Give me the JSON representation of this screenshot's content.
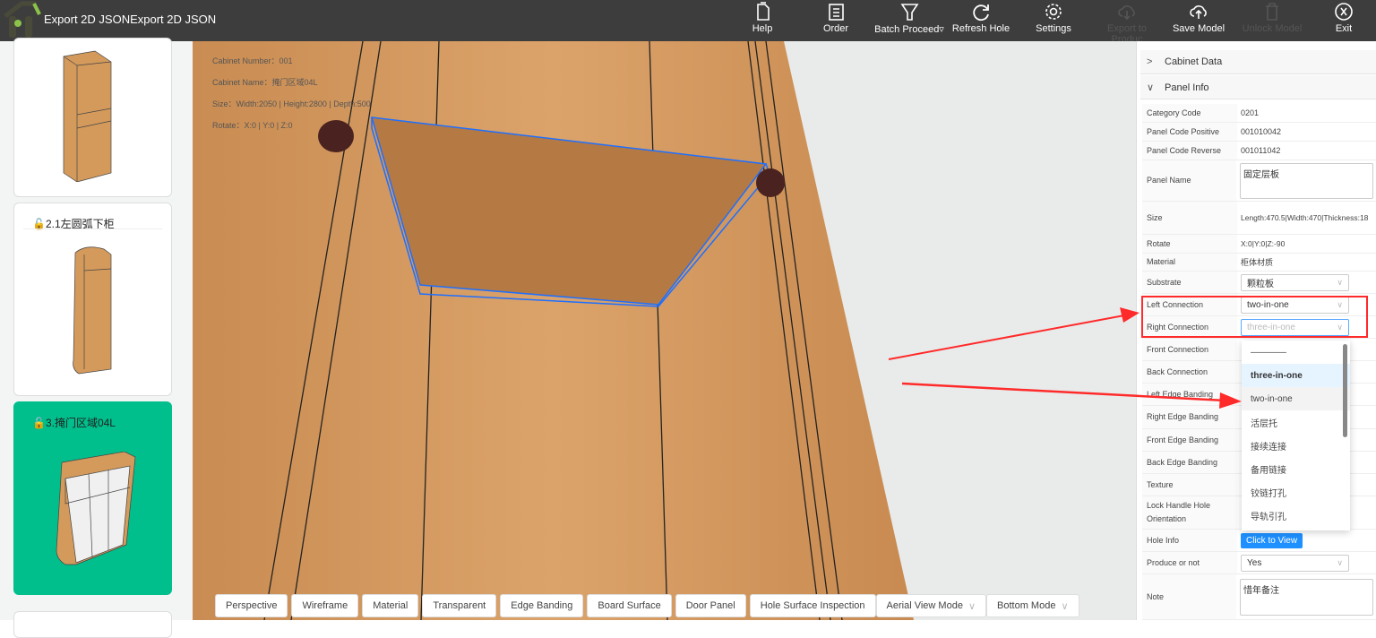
{
  "app": {
    "title": "Export 2D JSONExport 2D JSON"
  },
  "toolbar": [
    {
      "label": "Help",
      "icon": "help-doc-icon",
      "enabled": true
    },
    {
      "label": "Order",
      "icon": "order-list-icon",
      "enabled": true
    },
    {
      "label": "Batch Proceed▿",
      "icon": "funnel-icon",
      "enabled": true
    },
    {
      "label": "Refresh Hole",
      "icon": "refresh-icon",
      "enabled": true
    },
    {
      "label": "Settings",
      "icon": "gear-icon",
      "enabled": true
    },
    {
      "label": "Export to Produc",
      "icon": "cloud-download-icon",
      "enabled": false
    },
    {
      "label": "Save Model",
      "icon": "cloud-upload-icon",
      "enabled": true
    },
    {
      "label": "Unlock Model",
      "icon": "trash-icon",
      "enabled": false
    },
    {
      "label": "Exit",
      "icon": "close-circle-icon",
      "enabled": true
    }
  ],
  "sidebar": {
    "cards": [
      {
        "title": ""
      },
      {
        "title": "2.1左圆弧下柜"
      },
      {
        "title": "3.掩门区域04L",
        "selected": true
      }
    ],
    "selected_color": "#00bf8c"
  },
  "viewport": {
    "info": [
      "Cabinet Number：001",
      "Cabinet Name：掩门区域04L",
      "Size：Width:2050 | Height:2800 | Depth:500",
      "Rotate：X:0 | Y:0 | Z:0"
    ],
    "buttons": [
      "Perspective",
      "Wireframe",
      "Material",
      "Transparent",
      "Edge Banding",
      "Board Surface",
      "Door Panel",
      "Hole Surface Inspection"
    ],
    "selects": [
      "Aerial View Mode",
      "Bottom Mode"
    ]
  },
  "panel": {
    "sections": [
      "Cabinet Data",
      "Panel Info"
    ],
    "rows": [
      {
        "label": "Category Code",
        "value": "0201"
      },
      {
        "label": "Panel Code Positive",
        "value": "001010042"
      },
      {
        "label": "Panel Code Reverse",
        "value": "001011042"
      },
      {
        "label": "Panel Name",
        "value": "固定层板"
      },
      {
        "label": "Size",
        "value": "Length:470.5|Width:470|Thickness:18"
      },
      {
        "label": "Rotate",
        "value": "X:0|Y:0|Z:-90"
      },
      {
        "label": "Material",
        "value": "柜体材质"
      },
      {
        "label": "Substrate",
        "value": "颗粒板"
      },
      {
        "label": "Left Connection",
        "value": "two-in-one"
      },
      {
        "label": "Right Connection",
        "value": "three-in-one"
      },
      {
        "label": "Front Connection",
        "value": ""
      },
      {
        "label": "Back Connection",
        "value": ""
      },
      {
        "label": "Left Edge Banding",
        "value": ""
      },
      {
        "label": "Right Edge Banding",
        "value": ""
      },
      {
        "label": "Front Edge Banding",
        "value": ""
      },
      {
        "label": "Back Edge Banding",
        "value": ""
      },
      {
        "label": "Texture",
        "value": ""
      },
      {
        "label": "Lock Handle Hole Orientation",
        "value": ""
      },
      {
        "label": "Hole Info",
        "value": "Click to View"
      },
      {
        "label": "Produce or not",
        "value": "Yes"
      },
      {
        "label": "Note",
        "value": "惜年备注"
      }
    ],
    "dropdown_options": [
      "————",
      "three-in-one",
      "two-in-one",
      "活层托",
      "接续连接",
      "备用链接",
      "铰链打孔",
      "导轨引孔"
    ]
  },
  "colors": {
    "accent": "#1e90ff",
    "highlight": "#ff2a2a",
    "topbar": "#3d3d3d"
  }
}
